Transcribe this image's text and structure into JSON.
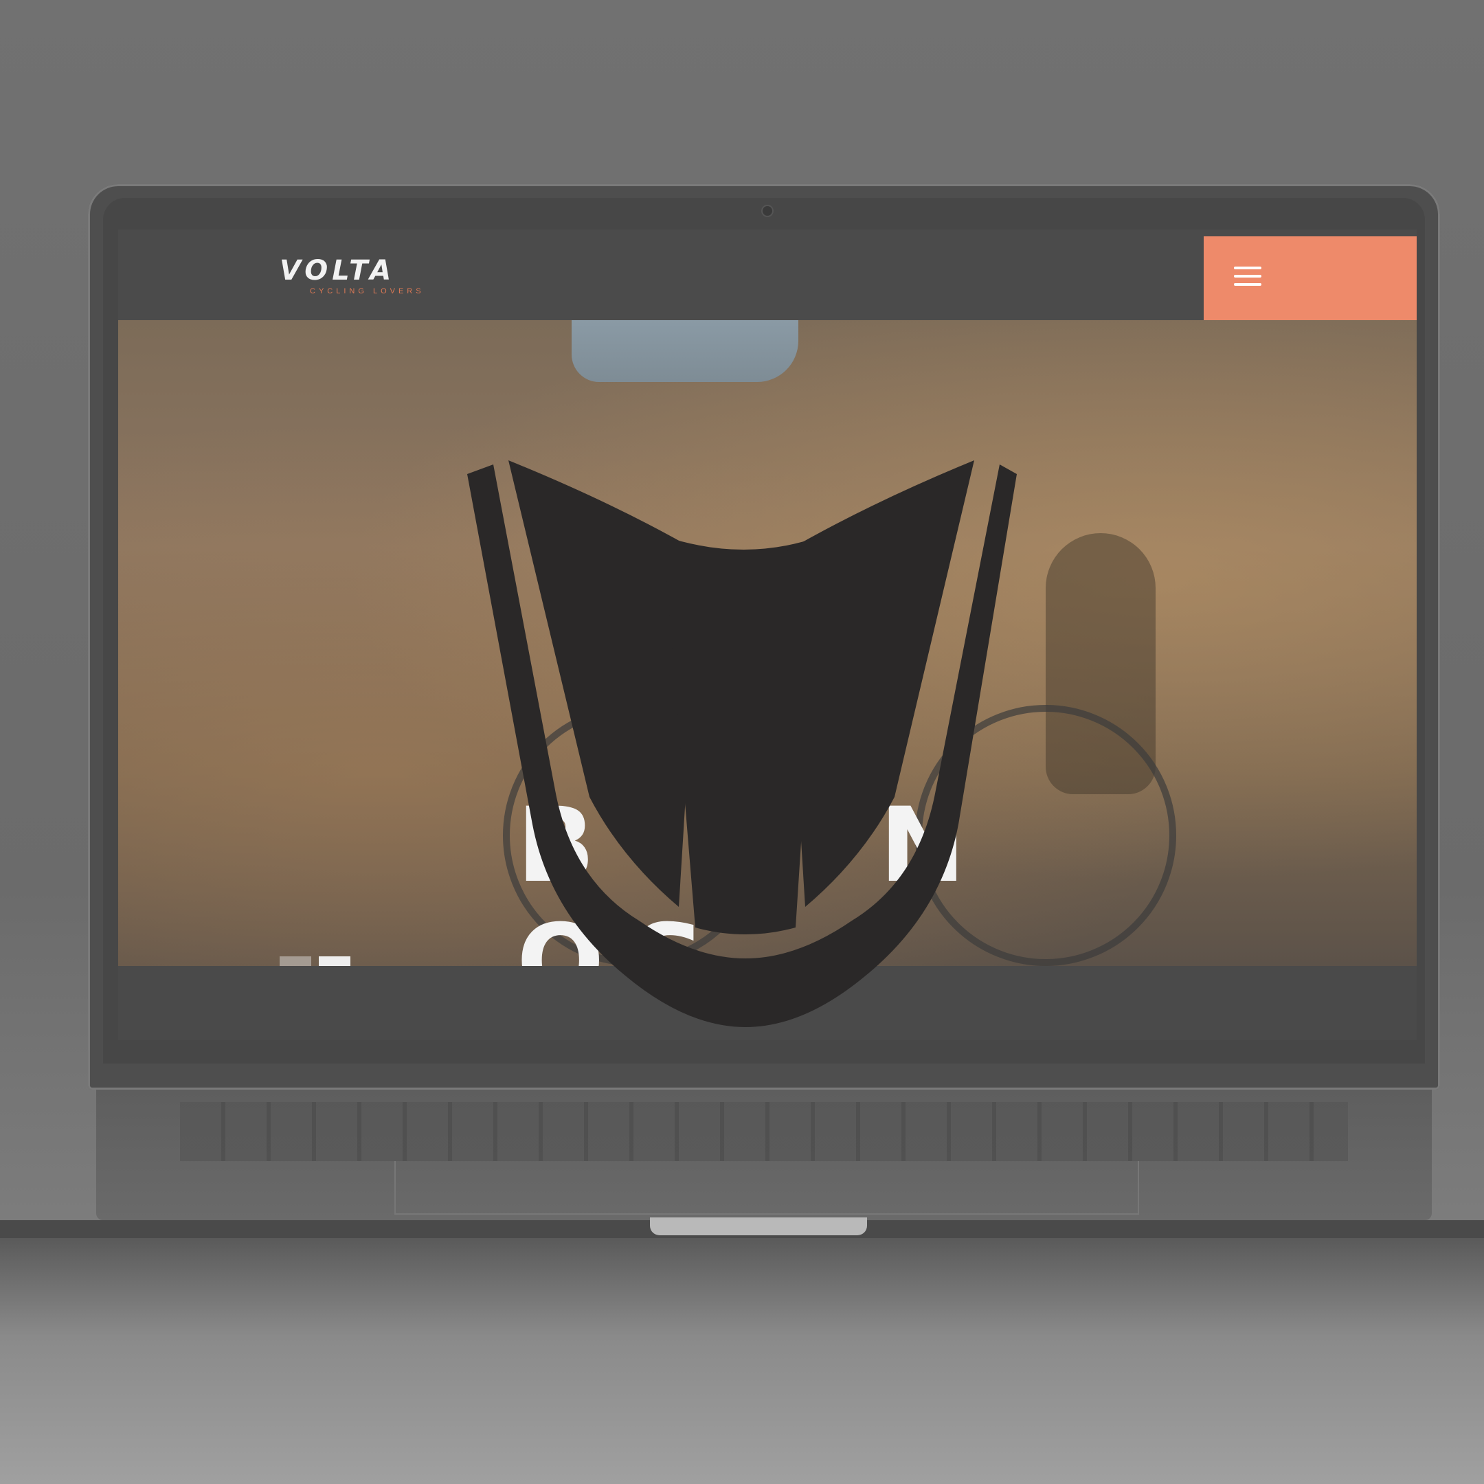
{
  "site": {
    "logo_word": "VOLTA",
    "logo_tagline": "CYCLING LOVERS",
    "menu_label": "Menu",
    "hero_title_visible": "B M N OS",
    "prev_arrow": "←",
    "next_arrow": "→"
  },
  "icons": {
    "menu": "hamburger-icon",
    "prev": "arrow-left-icon",
    "next": "arrow-right-icon",
    "emblem": "volta-shield-emblem-icon"
  },
  "colors": {
    "accent": "#ee8a6a",
    "emblem": "#2a2828",
    "background": "#6f6f6f"
  }
}
